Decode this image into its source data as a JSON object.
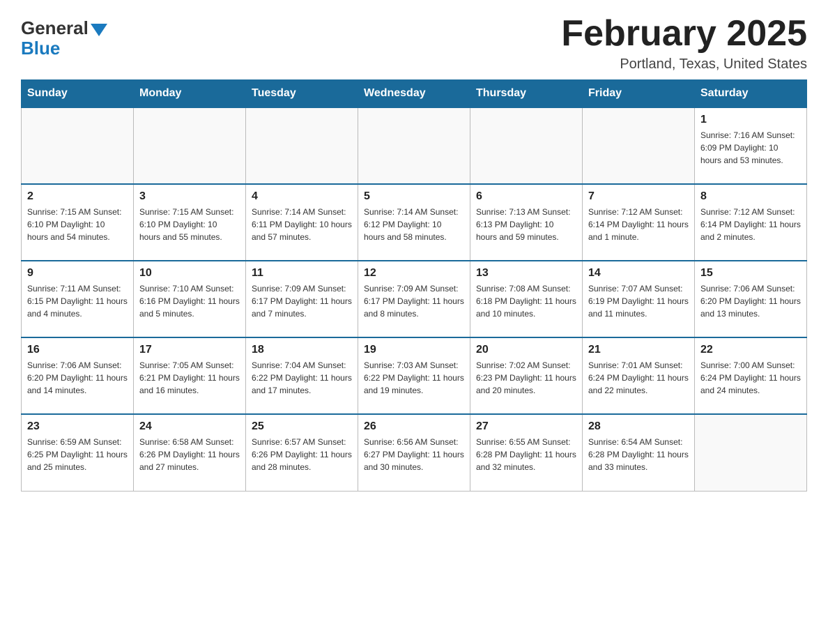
{
  "header": {
    "logo_general": "General",
    "logo_blue": "Blue",
    "title": "February 2025",
    "location": "Portland, Texas, United States"
  },
  "calendar": {
    "days_of_week": [
      "Sunday",
      "Monday",
      "Tuesday",
      "Wednesday",
      "Thursday",
      "Friday",
      "Saturday"
    ],
    "weeks": [
      [
        {
          "day": "",
          "info": ""
        },
        {
          "day": "",
          "info": ""
        },
        {
          "day": "",
          "info": ""
        },
        {
          "day": "",
          "info": ""
        },
        {
          "day": "",
          "info": ""
        },
        {
          "day": "",
          "info": ""
        },
        {
          "day": "1",
          "info": "Sunrise: 7:16 AM\nSunset: 6:09 PM\nDaylight: 10 hours and 53 minutes."
        }
      ],
      [
        {
          "day": "2",
          "info": "Sunrise: 7:15 AM\nSunset: 6:10 PM\nDaylight: 10 hours and 54 minutes."
        },
        {
          "day": "3",
          "info": "Sunrise: 7:15 AM\nSunset: 6:10 PM\nDaylight: 10 hours and 55 minutes."
        },
        {
          "day": "4",
          "info": "Sunrise: 7:14 AM\nSunset: 6:11 PM\nDaylight: 10 hours and 57 minutes."
        },
        {
          "day": "5",
          "info": "Sunrise: 7:14 AM\nSunset: 6:12 PM\nDaylight: 10 hours and 58 minutes."
        },
        {
          "day": "6",
          "info": "Sunrise: 7:13 AM\nSunset: 6:13 PM\nDaylight: 10 hours and 59 minutes."
        },
        {
          "day": "7",
          "info": "Sunrise: 7:12 AM\nSunset: 6:14 PM\nDaylight: 11 hours and 1 minute."
        },
        {
          "day": "8",
          "info": "Sunrise: 7:12 AM\nSunset: 6:14 PM\nDaylight: 11 hours and 2 minutes."
        }
      ],
      [
        {
          "day": "9",
          "info": "Sunrise: 7:11 AM\nSunset: 6:15 PM\nDaylight: 11 hours and 4 minutes."
        },
        {
          "day": "10",
          "info": "Sunrise: 7:10 AM\nSunset: 6:16 PM\nDaylight: 11 hours and 5 minutes."
        },
        {
          "day": "11",
          "info": "Sunrise: 7:09 AM\nSunset: 6:17 PM\nDaylight: 11 hours and 7 minutes."
        },
        {
          "day": "12",
          "info": "Sunrise: 7:09 AM\nSunset: 6:17 PM\nDaylight: 11 hours and 8 minutes."
        },
        {
          "day": "13",
          "info": "Sunrise: 7:08 AM\nSunset: 6:18 PM\nDaylight: 11 hours and 10 minutes."
        },
        {
          "day": "14",
          "info": "Sunrise: 7:07 AM\nSunset: 6:19 PM\nDaylight: 11 hours and 11 minutes."
        },
        {
          "day": "15",
          "info": "Sunrise: 7:06 AM\nSunset: 6:20 PM\nDaylight: 11 hours and 13 minutes."
        }
      ],
      [
        {
          "day": "16",
          "info": "Sunrise: 7:06 AM\nSunset: 6:20 PM\nDaylight: 11 hours and 14 minutes."
        },
        {
          "day": "17",
          "info": "Sunrise: 7:05 AM\nSunset: 6:21 PM\nDaylight: 11 hours and 16 minutes."
        },
        {
          "day": "18",
          "info": "Sunrise: 7:04 AM\nSunset: 6:22 PM\nDaylight: 11 hours and 17 minutes."
        },
        {
          "day": "19",
          "info": "Sunrise: 7:03 AM\nSunset: 6:22 PM\nDaylight: 11 hours and 19 minutes."
        },
        {
          "day": "20",
          "info": "Sunrise: 7:02 AM\nSunset: 6:23 PM\nDaylight: 11 hours and 20 minutes."
        },
        {
          "day": "21",
          "info": "Sunrise: 7:01 AM\nSunset: 6:24 PM\nDaylight: 11 hours and 22 minutes."
        },
        {
          "day": "22",
          "info": "Sunrise: 7:00 AM\nSunset: 6:24 PM\nDaylight: 11 hours and 24 minutes."
        }
      ],
      [
        {
          "day": "23",
          "info": "Sunrise: 6:59 AM\nSunset: 6:25 PM\nDaylight: 11 hours and 25 minutes."
        },
        {
          "day": "24",
          "info": "Sunrise: 6:58 AM\nSunset: 6:26 PM\nDaylight: 11 hours and 27 minutes."
        },
        {
          "day": "25",
          "info": "Sunrise: 6:57 AM\nSunset: 6:26 PM\nDaylight: 11 hours and 28 minutes."
        },
        {
          "day": "26",
          "info": "Sunrise: 6:56 AM\nSunset: 6:27 PM\nDaylight: 11 hours and 30 minutes."
        },
        {
          "day": "27",
          "info": "Sunrise: 6:55 AM\nSunset: 6:28 PM\nDaylight: 11 hours and 32 minutes."
        },
        {
          "day": "28",
          "info": "Sunrise: 6:54 AM\nSunset: 6:28 PM\nDaylight: 11 hours and 33 minutes."
        },
        {
          "day": "",
          "info": ""
        }
      ]
    ]
  }
}
